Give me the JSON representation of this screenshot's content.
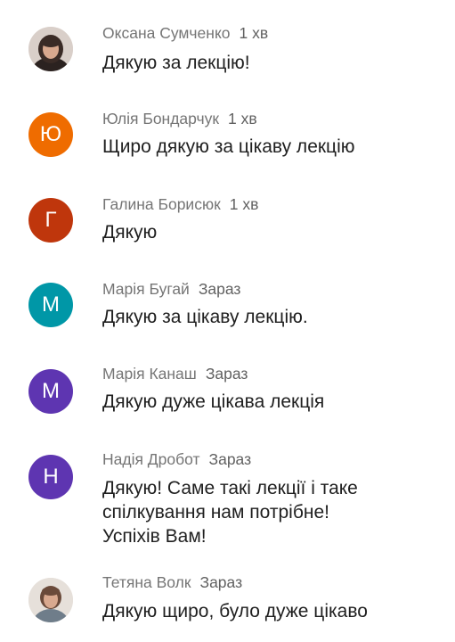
{
  "comments": [
    {
      "author": "Оксана Сумченко",
      "time": "1 хв",
      "text": "Дякую за лекцію!",
      "avatar_letter": "",
      "avatar_color": "#3a2b26",
      "avatar_type": "photo"
    },
    {
      "author": "Юлія Бондарчук",
      "time": "1 хв",
      "text": "Щиро дякую за цікаву лекцію",
      "avatar_letter": "Ю",
      "avatar_color": "#ef6c00",
      "avatar_type": "letter"
    },
    {
      "author": "Галина Борисюк",
      "time": "1 хв",
      "text": "Дякую",
      "avatar_letter": "Г",
      "avatar_color": "#bf360c",
      "avatar_type": "letter"
    },
    {
      "author": "Марія Бугай",
      "time": "Зараз",
      "text": "Дякую за цікаву лекцію.",
      "avatar_letter": "М",
      "avatar_color": "#0097a7",
      "avatar_type": "letter"
    },
    {
      "author": "Марія Канаш",
      "time": "Зараз",
      "text": "Дякую дуже цікава лекція",
      "avatar_letter": "М",
      "avatar_color": "#5e35b1",
      "avatar_type": "letter"
    },
    {
      "author": "Надія Дробот",
      "time": "Зараз",
      "text_lines": [
        "Дякую! Саме такі лекції і таке",
        "спілкування нам потрібне!",
        "Успіхів Вам!"
      ],
      "avatar_letter": "Н",
      "avatar_color": "#5e35b1",
      "avatar_type": "letter"
    },
    {
      "author": "Тетяна Волк",
      "time": "Зараз",
      "text": "Дякую щиро, було дуже цікаво",
      "avatar_letter": "",
      "avatar_color": "#7a5c4a",
      "avatar_type": "photo"
    }
  ]
}
